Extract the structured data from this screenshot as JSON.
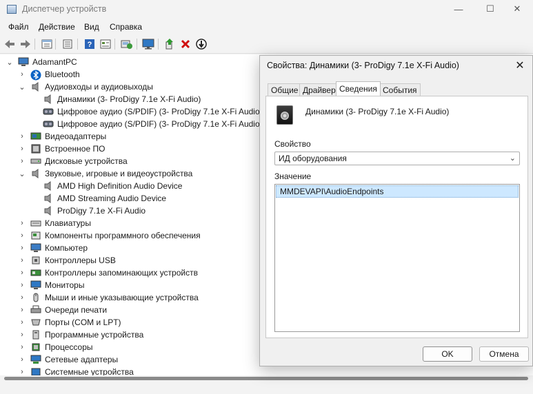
{
  "window": {
    "title": "Диспетчер устройств",
    "controls": {
      "minimize": "—",
      "maximize": "☐",
      "close": "✕"
    }
  },
  "menu": [
    "Файл",
    "Действие",
    "Вид",
    "Справка"
  ],
  "toolbar_icons": [
    "back-icon",
    "forward-icon",
    "properties-sheet-icon",
    "view-icon",
    "help-icon",
    "details-icon",
    "scan-hardware-icon",
    "monitor-icon",
    "update-driver-icon",
    "uninstall-icon",
    "disable-device-icon"
  ],
  "tree": {
    "root": "AdamantPC",
    "nodes": [
      {
        "label": "Bluetooth",
        "expanded": false,
        "icon": "bluetooth-icon"
      },
      {
        "label": "Аудиовходы и аудиовыходы",
        "expanded": true,
        "icon": "speaker-icon",
        "children": [
          {
            "label": "Динамики (3- ProDigy 7.1e X-Fi Audio)",
            "icon": "speaker-icon"
          },
          {
            "label": "Цифровое аудио (S/PDIF) (3- ProDigy 7.1e X-Fi Audio)",
            "icon": "spdif-icon"
          },
          {
            "label": "Цифровое аудио (S/PDIF) (3- ProDigy 7.1e X-Fi Audio)",
            "icon": "spdif-icon"
          }
        ]
      },
      {
        "label": "Видеоадаптеры",
        "expanded": false,
        "icon": "display-adapter-icon"
      },
      {
        "label": "Встроенное ПО",
        "expanded": false,
        "icon": "firmware-icon"
      },
      {
        "label": "Дисковые устройства",
        "expanded": false,
        "icon": "disk-drive-icon"
      },
      {
        "label": "Звуковые, игровые и видеоустройства",
        "expanded": true,
        "icon": "sound-icon",
        "children": [
          {
            "label": "AMD High Definition Audio Device",
            "icon": "speaker-icon"
          },
          {
            "label": "AMD Streaming Audio Device",
            "icon": "speaker-icon"
          },
          {
            "label": "ProDigy 7.1e X-Fi Audio",
            "icon": "speaker-icon"
          }
        ]
      },
      {
        "label": "Клавиатуры",
        "expanded": false,
        "icon": "keyboard-icon"
      },
      {
        "label": "Компоненты программного обеспечения",
        "expanded": false,
        "icon": "software-component-icon"
      },
      {
        "label": "Компьютер",
        "expanded": false,
        "icon": "computer-icon"
      },
      {
        "label": "Контроллеры USB",
        "expanded": false,
        "icon": "usb-icon"
      },
      {
        "label": "Контроллеры запоминающих устройств",
        "expanded": false,
        "icon": "storage-controller-icon"
      },
      {
        "label": "Мониторы",
        "expanded": false,
        "icon": "monitor-icon"
      },
      {
        "label": "Мыши и иные указывающие устройства",
        "expanded": false,
        "icon": "mouse-icon"
      },
      {
        "label": "Очереди печати",
        "expanded": false,
        "icon": "printer-icon"
      },
      {
        "label": "Порты (COM и LPT)",
        "expanded": false,
        "icon": "port-icon"
      },
      {
        "label": "Программные устройства",
        "expanded": false,
        "icon": "software-device-icon"
      },
      {
        "label": "Процессоры",
        "expanded": false,
        "icon": "processor-icon"
      },
      {
        "label": "Сетевые адаптеры",
        "expanded": false,
        "icon": "network-adapter-icon"
      },
      {
        "label": "Системные устройства",
        "expanded": false,
        "icon": "system-device-icon"
      }
    ]
  },
  "dialog": {
    "title": "Свойства: Динамики (3- ProDigy 7.1e X-Fi Audio)",
    "close": "✕",
    "tabs": [
      "Общие",
      "Драйвер",
      "Сведения",
      "События"
    ],
    "active_tab": "Сведения",
    "device_name": "Динамики (3- ProDigy 7.1e X-Fi Audio)",
    "property_label": "Свойство",
    "property_value": "ИД оборудования",
    "value_label": "Значение",
    "value_items": [
      "MMDEVAPI\\AudioEndpoints"
    ],
    "ok": "OK",
    "cancel": "Отмена"
  },
  "colors": {
    "selection": "#cde8ff",
    "accent": "#0067c0",
    "uninstall_red": "#d01010"
  }
}
